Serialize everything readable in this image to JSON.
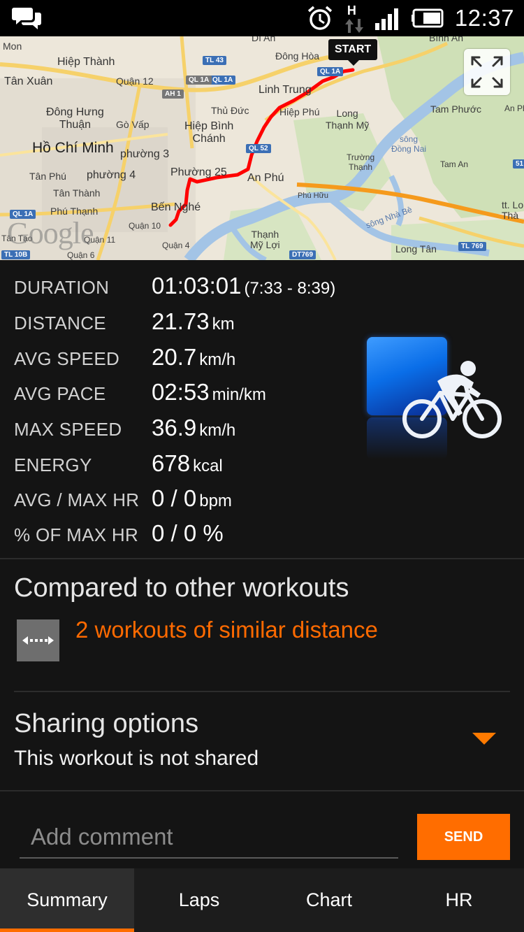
{
  "status_bar": {
    "time": "12:37",
    "network_label": "H"
  },
  "map": {
    "start_label": "START",
    "watermark": "Google",
    "place_labels": {
      "mon": "Mon",
      "hiep_thanh": "Hiệp Thành",
      "tan_xuan": "Tân Xuân",
      "quan12": "Quận 12",
      "dong_hung_thuan": "Đông Hưng\nThuận",
      "go_vap": "Gò Vấp",
      "ho_chi_minh": "Hồ Chí Minh",
      "phuong3": "phường 3",
      "tan_phu": "Tân Phú",
      "phuong4": "phường 4",
      "tan_thanh": "Tân Thành",
      "phu_thanh": "Phú Thạnh",
      "phuong25": "Phường 25",
      "ben_nghe": "Bến Nghé",
      "quan10": "Quận 10",
      "quan11": "Quận 11",
      "quan4": "Quận 4",
      "quan6": "Quận 6",
      "tan_tao": "Tân Tạo",
      "hiep_binh_chanh": "Hiệp Bình\nChánh",
      "thu_duc": "Thủ Đức",
      "linh_trung": "Linh Trung",
      "hiep_phu": "Hiệp Phú",
      "dong_hoa": "Đông Hòa",
      "di_an": "Dĩ An",
      "long_thanh_my": "Long\nThạnh Mỹ",
      "an_phu": "An Phú",
      "truong_thanh": "Trường\nThạnh",
      "song_dong_nai": "sông\nĐồng Nai",
      "tam_phuoc": "Tam Phước",
      "an_phu2": "An Phư",
      "tam_an": "Tam An",
      "phu_huu": "Phú Hữu",
      "song_nha_be": "sông Nhà Bè",
      "thanh_my_loi": "Thạnh\nMỹ Lợi",
      "long_tan": "Long Tân",
      "tt_long_thanh": "tt. Lo\nThà",
      "binh_an": "Bình An"
    },
    "road_shields": {
      "ql1a_a": "QL 1A",
      "tl43": "TL 43",
      "ql1a_b": "QL 1A",
      "ah1": "AH 1",
      "ql1a_c": "QL 1A",
      "ql52": "QL 52",
      "ql1a_d": "QL 1A",
      "tl10b": "TL 10B",
      "dt769": "DT769",
      "tl769": "TL 769",
      "n51": "51"
    }
  },
  "stats": [
    {
      "label": "DURATION",
      "value": "01:03:01",
      "unit": "(7:33 - 8:39)"
    },
    {
      "label": "DISTANCE",
      "value": "21.73",
      "unit": "km"
    },
    {
      "label": "AVG SPEED",
      "value": "20.7",
      "unit": "km/h"
    },
    {
      "label": "AVG PACE",
      "value": "02:53",
      "unit": "min/km"
    },
    {
      "label": "MAX SPEED",
      "value": "36.9",
      "unit": "km/h"
    },
    {
      "label": "ENERGY",
      "value": "678",
      "unit": "kcal"
    },
    {
      "label": "AVG / MAX HR",
      "value": "0 / 0",
      "unit": "bpm"
    },
    {
      "label": "% OF MAX HR",
      "value": "0 / 0 %",
      "unit": ""
    }
  ],
  "compare": {
    "title": "Compared to other workouts",
    "link": "2 workouts of similar distance"
  },
  "sharing": {
    "title": "Sharing options",
    "status": "This workout is not shared"
  },
  "comment": {
    "placeholder": "Add comment",
    "send_label": "SEND"
  },
  "tabs": [
    {
      "label": "Summary",
      "active": true
    },
    {
      "label": "Laps",
      "active": false
    },
    {
      "label": "Chart",
      "active": false
    },
    {
      "label": "HR",
      "active": false
    }
  ],
  "colors": {
    "accent": "#ff6d00",
    "route": "#ff0000",
    "background": "#141414"
  }
}
